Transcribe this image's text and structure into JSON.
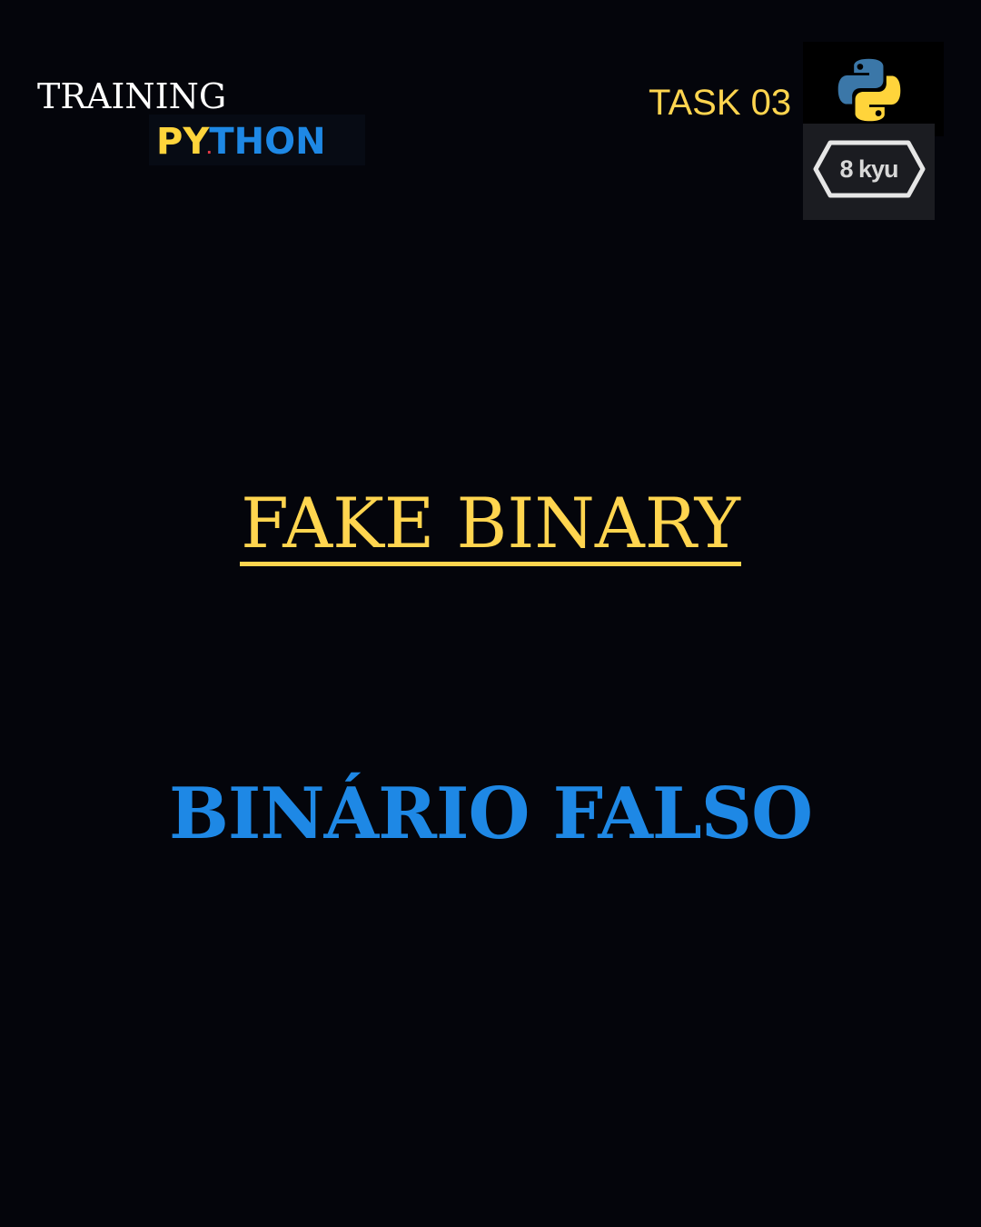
{
  "header": {
    "brand_top": "TRAINING",
    "brand_py": "PY",
    "brand_dot": ".",
    "brand_thon": "THON",
    "task": "TASK 03",
    "python_logo_icon": "python-logo-icon",
    "rank_badge": "8 kyu"
  },
  "main": {
    "title_en": "FAKE BINARY",
    "title_pt": "BINÁRIO FALSO"
  },
  "colors": {
    "background": "#04050b",
    "yellow": "#ffd54f",
    "blue": "#1e88e5",
    "white": "#ffffff"
  }
}
